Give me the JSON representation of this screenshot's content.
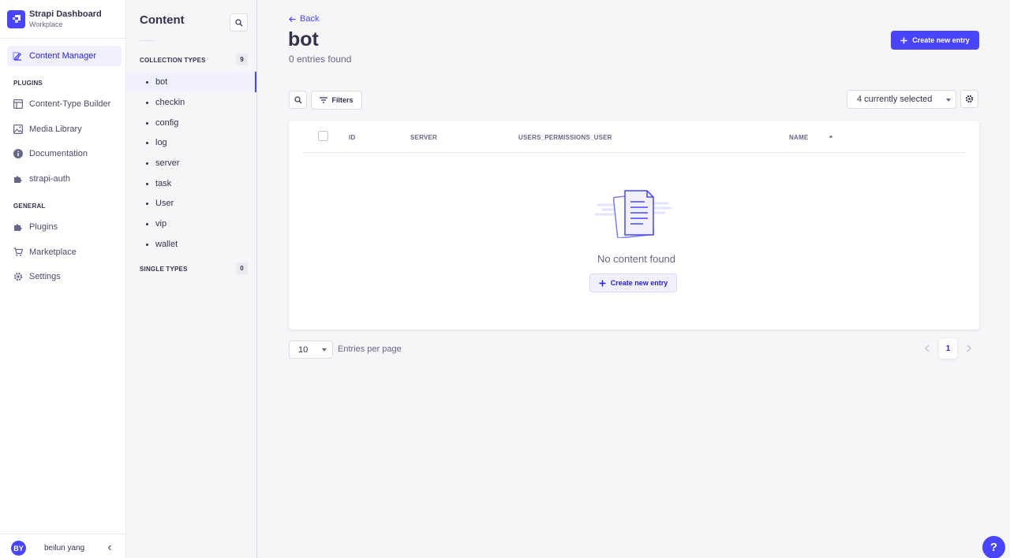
{
  "brand": {
    "title": "Strapi Dashboard",
    "subtitle": "Workplace"
  },
  "mainnav": {
    "active_item": "Content Manager",
    "plugins_heading": "PLUGINS",
    "plugins": [
      "Content-Type Builder",
      "Media Library",
      "Documentation",
      "strapi-auth"
    ],
    "general_heading": "GENERAL",
    "general": [
      "Plugins",
      "Marketplace",
      "Settings"
    ]
  },
  "user": {
    "initials": "BY",
    "name": "beilun yang"
  },
  "subnav": {
    "title": "Content",
    "collection_heading": "COLLECTION TYPES",
    "collection_count": "9",
    "collection_types": [
      "bot",
      "checkin",
      "config",
      "log",
      "server",
      "task",
      "User",
      "vip",
      "wallet"
    ],
    "active_type": "bot",
    "single_heading": "SINGLE TYPES",
    "single_count": "0"
  },
  "header": {
    "back_label": "Back",
    "title": "bot",
    "subtitle": "0 entries found",
    "create_label": "Create new entry"
  },
  "toolbar": {
    "filters_label": "Filters",
    "columns_selected": "4 currently selected"
  },
  "table": {
    "columns": [
      "ID",
      "SERVER",
      "USERS_PERMISSIONS_USER",
      "NAME"
    ],
    "empty_text": "No content found",
    "empty_create_label": "Create new entry"
  },
  "pagination": {
    "per_page": "10",
    "per_page_label": "Entries per page",
    "current_page": "1"
  },
  "help": {
    "label": "?"
  },
  "colors": {
    "primary": "#4945ff",
    "active_bg": "#f0f0ff",
    "text": "#32324d",
    "muted": "#666687"
  }
}
